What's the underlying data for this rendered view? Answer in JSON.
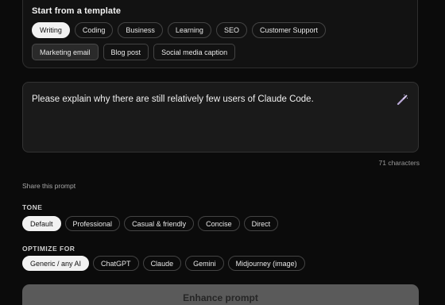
{
  "templates": {
    "title": "Start from a template",
    "row1": [
      "Writing",
      "Coding",
      "Business",
      "Learning",
      "SEO",
      "Customer Support"
    ],
    "row2": [
      "Marketing email",
      "Blog post",
      "Social media caption"
    ]
  },
  "prompt": {
    "value": "Please explain why there are still relatively few users of Claude Code.",
    "char_count": "71 characters",
    "enhance_icon": "magic-wand-icon"
  },
  "share": {
    "label": "Share this prompt"
  },
  "tone": {
    "label": "TONE",
    "options": [
      "Default",
      "Professional",
      "Casual & friendly",
      "Concise",
      "Direct"
    ],
    "selected": "Default"
  },
  "optimize": {
    "label": "OPTIMIZE FOR",
    "options": [
      "Generic / any AI",
      "ChatGPT",
      "Claude",
      "Gemini",
      "Midjourney (image)"
    ],
    "selected": "Generic / any AI"
  },
  "enhance_button": {
    "label": "Enhance prompt"
  },
  "colors": {
    "background": "#0b0b0b",
    "active_chip": "#f2f2f2",
    "button": "#5a5a5a"
  }
}
